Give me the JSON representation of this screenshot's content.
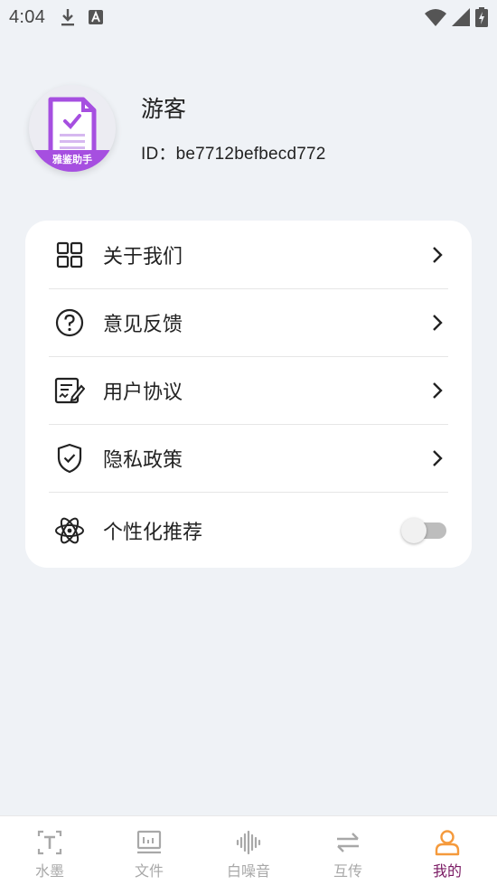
{
  "status_bar": {
    "time": "4:04",
    "icons": [
      "download-icon",
      "a-icon",
      "wifi-icon",
      "signal-icon",
      "battery-icon"
    ]
  },
  "profile": {
    "avatar_caption": "雅鉴助手",
    "username": "游客",
    "id_text": "ID：be7712befbecd772"
  },
  "menu": {
    "items": [
      {
        "label": "关于我们",
        "icon": "grid-icon"
      },
      {
        "label": "意见反馈",
        "icon": "question-circle-icon"
      },
      {
        "label": "用户协议",
        "icon": "document-pen-icon"
      },
      {
        "label": "隐私政策",
        "icon": "shield-check-icon"
      }
    ],
    "toggle_item": {
      "label": "个性化推荐",
      "icon": "atom-icon",
      "enabled": false
    }
  },
  "tab_bar": {
    "tabs": [
      {
        "label": "水墨",
        "icon": "text-t-icon",
        "active": false
      },
      {
        "label": "文件",
        "icon": "file-board-icon",
        "active": false
      },
      {
        "label": "白噪音",
        "icon": "waveform-icon",
        "active": false
      },
      {
        "label": "互传",
        "icon": "transfer-arrows-icon",
        "active": false
      },
      {
        "label": "我的",
        "icon": "person-icon",
        "active": true
      }
    ]
  },
  "colors": {
    "accent": "#7a1a63",
    "avatar_band": "#a64fe0",
    "active_tab_icon": "#f59a3c",
    "inactive_tab": "#a8a8a8",
    "background": "#eff2f6"
  }
}
